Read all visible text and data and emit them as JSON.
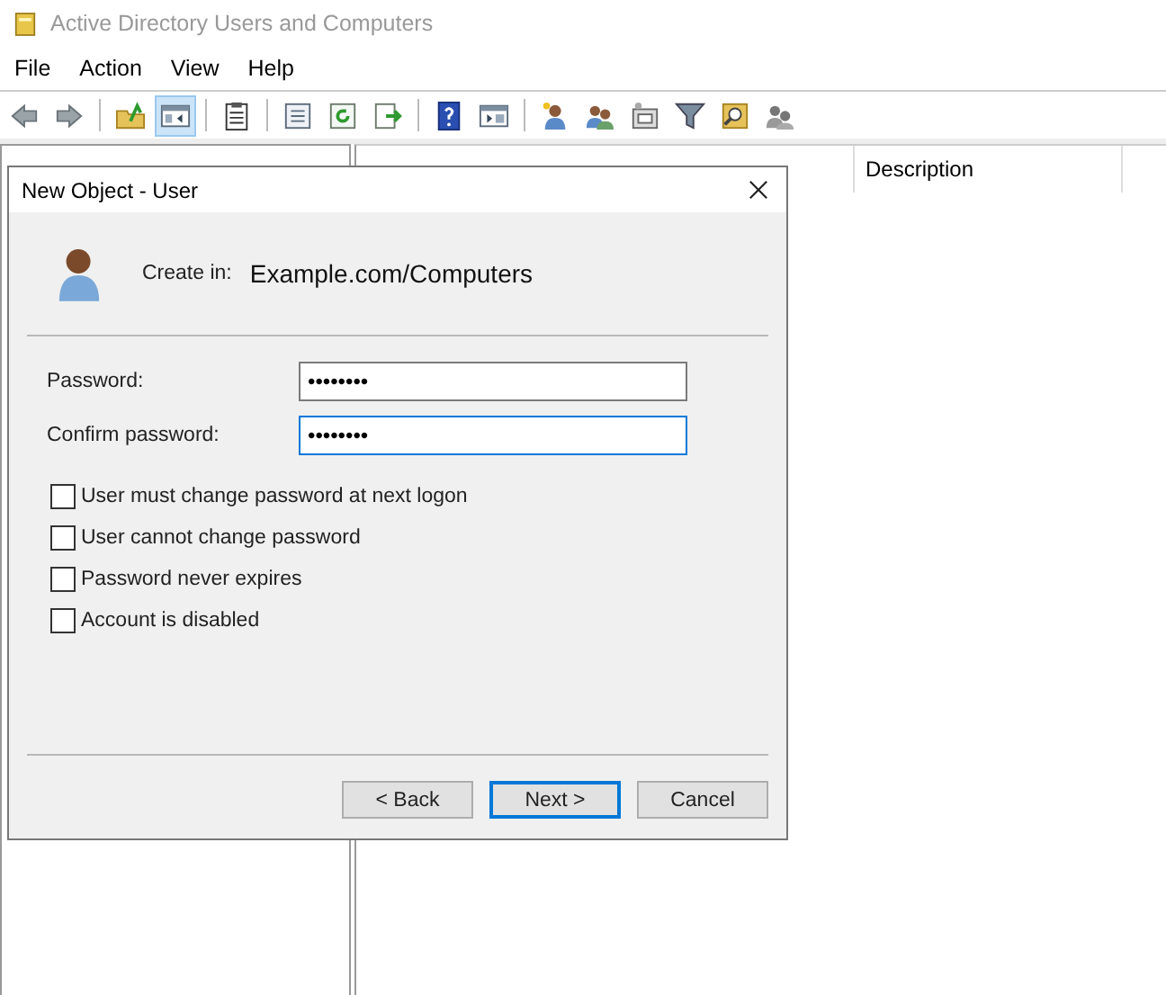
{
  "window": {
    "title": "Active Directory Users and Computers"
  },
  "menu": [
    "File",
    "Action",
    "View",
    "Help"
  ],
  "toolbar": [
    {
      "kind": "back",
      "selected": false
    },
    {
      "kind": "forward",
      "selected": false
    },
    {
      "kind": "sep"
    },
    {
      "kind": "folder-up",
      "selected": false
    },
    {
      "kind": "tree",
      "selected": true
    },
    {
      "kind": "sep"
    },
    {
      "kind": "clipboard",
      "selected": false
    },
    {
      "kind": "sep"
    },
    {
      "kind": "properties",
      "selected": false
    },
    {
      "kind": "refresh",
      "selected": false
    },
    {
      "kind": "export",
      "selected": false
    },
    {
      "kind": "sep"
    },
    {
      "kind": "help",
      "selected": false
    },
    {
      "kind": "panel",
      "selected": false
    },
    {
      "kind": "sep"
    },
    {
      "kind": "user",
      "selected": false
    },
    {
      "kind": "group",
      "selected": false
    },
    {
      "kind": "ou",
      "selected": false
    },
    {
      "kind": "filter",
      "selected": false
    },
    {
      "kind": "find",
      "selected": false
    },
    {
      "kind": "delegate",
      "selected": false
    }
  ],
  "list": {
    "columns": [
      "Description"
    ]
  },
  "dialog": {
    "title": "New Object - User",
    "create_in_label": "Create in:",
    "create_in_path": "Example.com/Computers",
    "fields": [
      {
        "label": "Password:",
        "value": "••••••••",
        "focused": false
      },
      {
        "label": "Confirm password:",
        "value": "••••••••",
        "focused": true
      }
    ],
    "options": [
      {
        "label": "User must change password at next logon",
        "checked": false
      },
      {
        "label": "User cannot change password",
        "checked": false
      },
      {
        "label": "Password never expires",
        "checked": false
      },
      {
        "label": "Account is disabled",
        "checked": false
      }
    ],
    "buttons": [
      {
        "label": "< Back",
        "default": false
      },
      {
        "label": "Next >",
        "default": true
      },
      {
        "label": "Cancel",
        "default": false
      }
    ]
  }
}
